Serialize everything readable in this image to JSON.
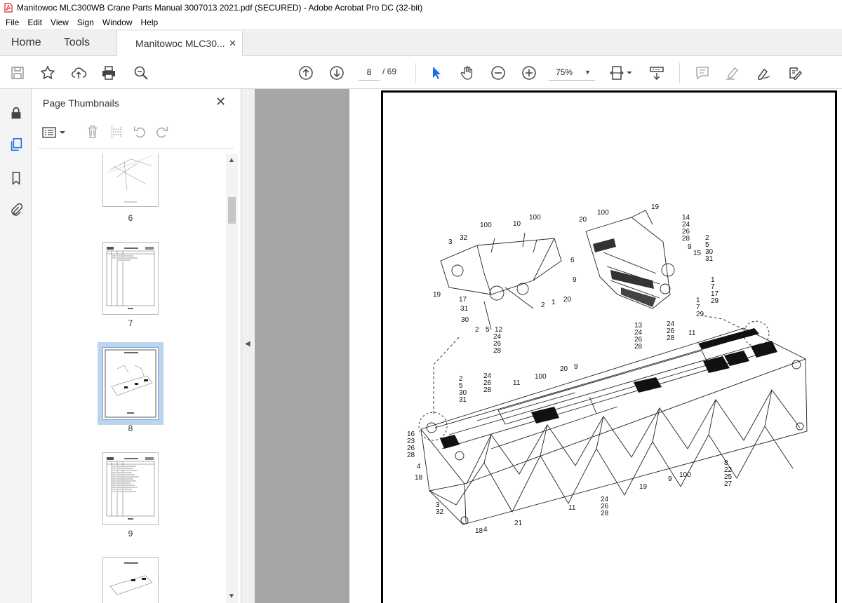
{
  "window": {
    "title": "Manitowoc MLC300WB Crane Parts Manual 3007013 2021.pdf (SECURED) - Adobe Acrobat Pro DC (32-bit)"
  },
  "menu": [
    "File",
    "Edit",
    "View",
    "Sign",
    "Window",
    "Help"
  ],
  "tabs": {
    "home": "Home",
    "tools": "Tools",
    "document": "Manitowoc MLC30...",
    "close": "✕"
  },
  "toolbar": {
    "page_current": "8",
    "page_total": "/ 69",
    "zoom": "75%"
  },
  "panel": {
    "title": "Page Thumbnails",
    "close": "✕"
  },
  "thumbnails": [
    {
      "label": "6"
    },
    {
      "label": "7"
    },
    {
      "label": "8",
      "selected": true
    },
    {
      "label": "9"
    },
    {
      "label": ""
    }
  ],
  "diagram": {
    "callouts": [
      "100",
      "10",
      "100",
      "3",
      "32",
      "6",
      "9",
      "20",
      "19",
      "17",
      "31",
      "30",
      "2",
      "5",
      "12",
      "24",
      "26",
      "28",
      "1",
      "2",
      "20",
      "100",
      "19",
      "14",
      "24",
      "26",
      "28",
      "2",
      "5",
      "30",
      "31",
      "9",
      "15",
      "1",
      "7",
      "17",
      "29",
      "1",
      "7",
      "29",
      "13",
      "24",
      "26",
      "28",
      "24",
      "26",
      "28",
      "11",
      "20",
      "9",
      "100",
      "24",
      "26",
      "28",
      "11",
      "2",
      "5",
      "30",
      "31",
      "16",
      "23",
      "26",
      "28",
      "4",
      "18",
      "3",
      "32",
      "21",
      "18",
      "4",
      "11",
      "24",
      "26",
      "28",
      "19",
      "9",
      "100",
      "8",
      "22",
      "25",
      "27"
    ]
  }
}
